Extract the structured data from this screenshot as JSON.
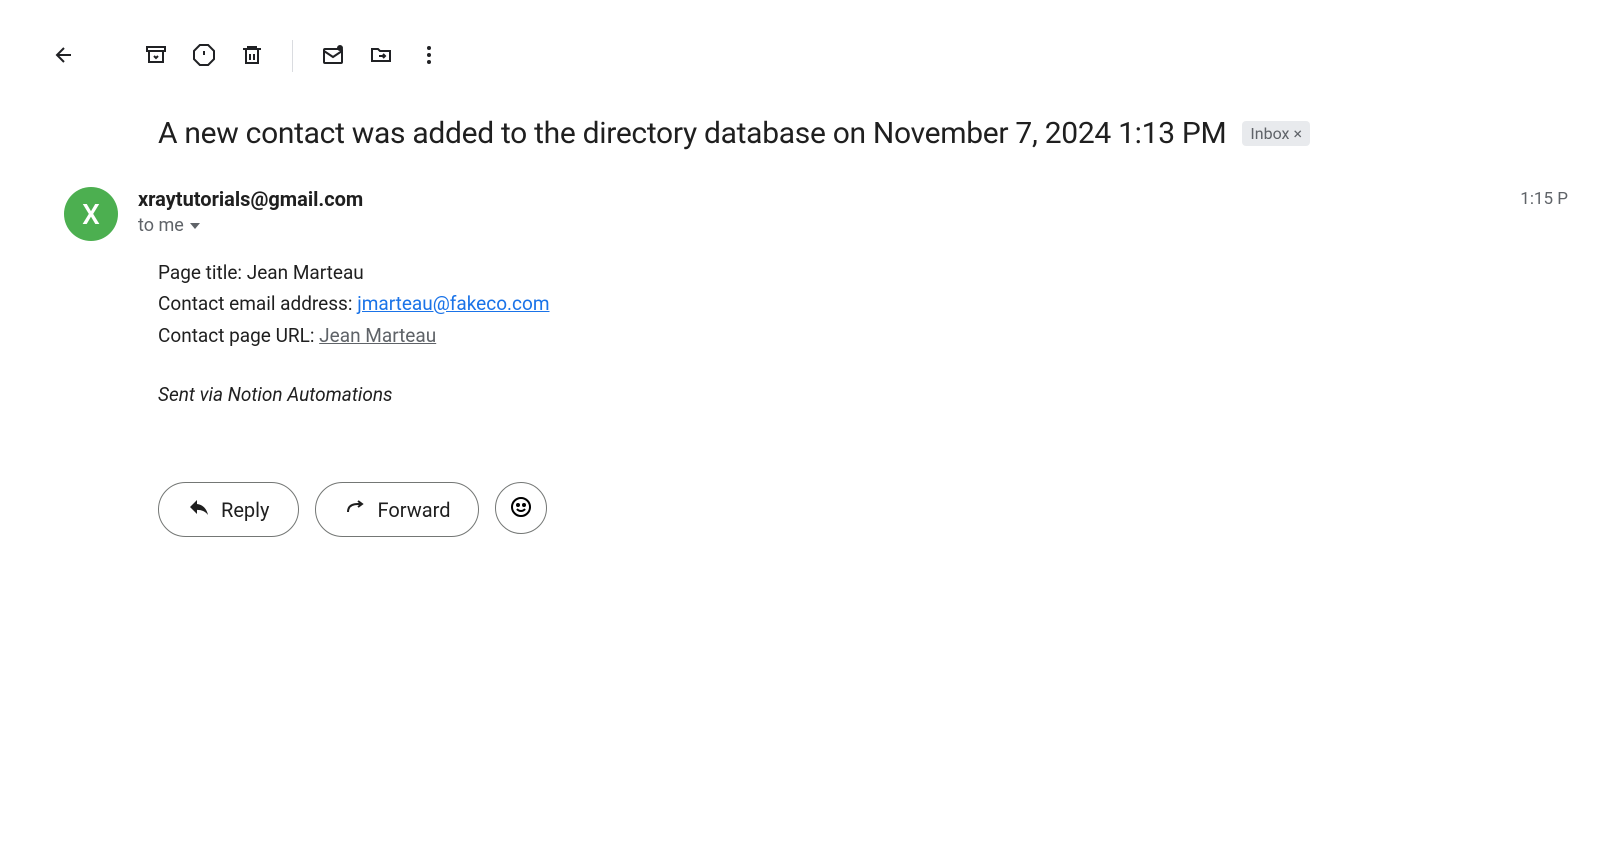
{
  "email": {
    "subject": "A new contact was added to the directory database on November 7, 2024 1:13 PM",
    "inbox_label": "Inbox",
    "sender": "xraytutorials@gmail.com",
    "sender_initial": "X",
    "recipient_label": "to me",
    "timestamp": "1:15 P",
    "body": {
      "page_title_label": "Page title: ",
      "page_title_value": "Jean Marteau",
      "contact_email_label": "Contact email address: ",
      "contact_email_value": "jmarteau@fakeco.com",
      "contact_url_label": "Contact page URL: ",
      "contact_url_value": "Jean Marteau",
      "signature": "Sent via Notion Automations"
    },
    "actions": {
      "reply_label": "Reply",
      "forward_label": "Forward"
    }
  }
}
